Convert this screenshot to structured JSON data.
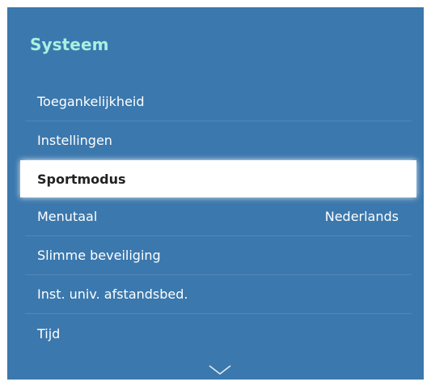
{
  "menu": {
    "title": "Systeem",
    "items": [
      {
        "label": "Toegankelijkheid",
        "value": ""
      },
      {
        "label": "Instellingen",
        "value": ""
      },
      {
        "label": "Sportmodus",
        "value": "",
        "selected": true
      },
      {
        "label": "Menutaal",
        "value": "Nederlands"
      },
      {
        "label": "Slimme beveiliging",
        "value": ""
      },
      {
        "label": "Inst. univ. afstandsbed.",
        "value": ""
      },
      {
        "label": "Tijd",
        "value": ""
      }
    ],
    "scroll_icon": "chevron-down-icon"
  },
  "colors": {
    "panel_background": "#3b78ad",
    "title": "#a9f0e0",
    "item_text": "#ffffff",
    "selected_background": "#ffffff",
    "selected_text": "#222222"
  }
}
